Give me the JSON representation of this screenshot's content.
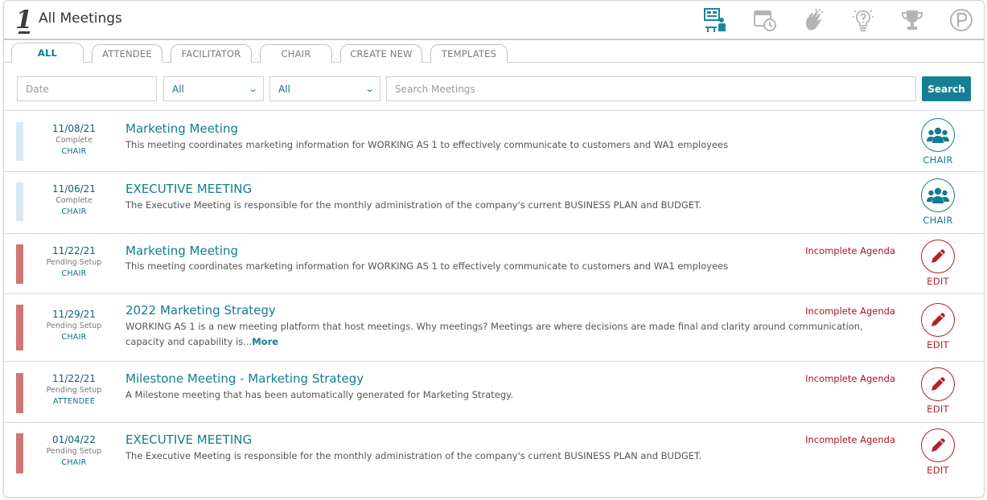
{
  "header": {
    "logo": "1",
    "title": "All Meetings",
    "icons": [
      "presentation-icon",
      "calendar-clock-icon",
      "clapping-hands-icon",
      "lightbulb-question-icon",
      "trophy-icon",
      "parking-icon"
    ]
  },
  "tabs": [
    {
      "label": "ALL",
      "active": true
    },
    {
      "label": "ATTENDEE",
      "active": false
    },
    {
      "label": "FACILITATOR",
      "active": false
    },
    {
      "label": "CHAIR",
      "active": false
    },
    {
      "label": "CREATE NEW",
      "active": false
    },
    {
      "label": "TEMPLATES",
      "active": false
    }
  ],
  "filters": {
    "date_placeholder": "Date",
    "select1_value": "All",
    "select2_value": "All",
    "search_placeholder": "Search Meetings",
    "search_button": "Search"
  },
  "colors": {
    "accent": "#147c90",
    "complete_bar": "#d6eaf1",
    "pending_bar": "#cf7776",
    "warning": "#a81522"
  },
  "meetings": [
    {
      "date": "11/08/21",
      "status": "Complete",
      "role": "CHAIR",
      "title": "Marketing Meeting",
      "description": "This meeting coordinates marketing information for WORKING AS 1 to effectively communicate to customers and WA1 employees",
      "warning": "",
      "action": "CHAIR",
      "action_icon": "group-icon"
    },
    {
      "date": "11/06/21",
      "status": "Complete",
      "role": "CHAIR",
      "title": "EXECUTIVE MEETING",
      "description": "The Executive Meeting is responsible for the monthly administration of the company's current BUSINESS PLAN and BUDGET.",
      "warning": "",
      "action": "CHAIR",
      "action_icon": "group-icon"
    },
    {
      "date": "11/22/21",
      "status": "Pending Setup",
      "role": "CHAIR",
      "title": "Marketing Meeting",
      "description": "This meeting coordinates marketing information for WORKING AS 1 to effectively communicate to customers and WA1 employees",
      "warning": "Incomplete Agenda",
      "action": "EDIT",
      "action_icon": "pencil-icon"
    },
    {
      "date": "11/29/21",
      "status": "Pending Setup",
      "role": "CHAIR",
      "title": "2022 Marketing Strategy",
      "description": "WORKING AS 1 is a new meeting platform that host meetings. Why meetings? Meetings are where decisions are made final and clarity around communication, capacity and capability is...",
      "more": "More",
      "warning": "Incomplete Agenda",
      "action": "EDIT",
      "action_icon": "pencil-icon"
    },
    {
      "date": "11/22/21",
      "status": "Pending Setup",
      "role": "ATTENDEE",
      "title": "Milestone Meeting - Marketing Strategy",
      "description": "A Milestone meeting that has been automatically generated for Marketing Strategy.",
      "warning": "Incomplete Agenda",
      "action": "EDIT",
      "action_icon": "pencil-icon"
    },
    {
      "date": "01/04/22",
      "status": "Pending Setup",
      "role": "CHAIR",
      "title": "EXECUTIVE MEETING",
      "description": "The Executive Meeting is responsible for the monthly administration of the company's current BUSINESS PLAN and BUDGET.",
      "warning": "Incomplete Agenda",
      "action": "EDIT",
      "action_icon": "pencil-icon"
    }
  ]
}
